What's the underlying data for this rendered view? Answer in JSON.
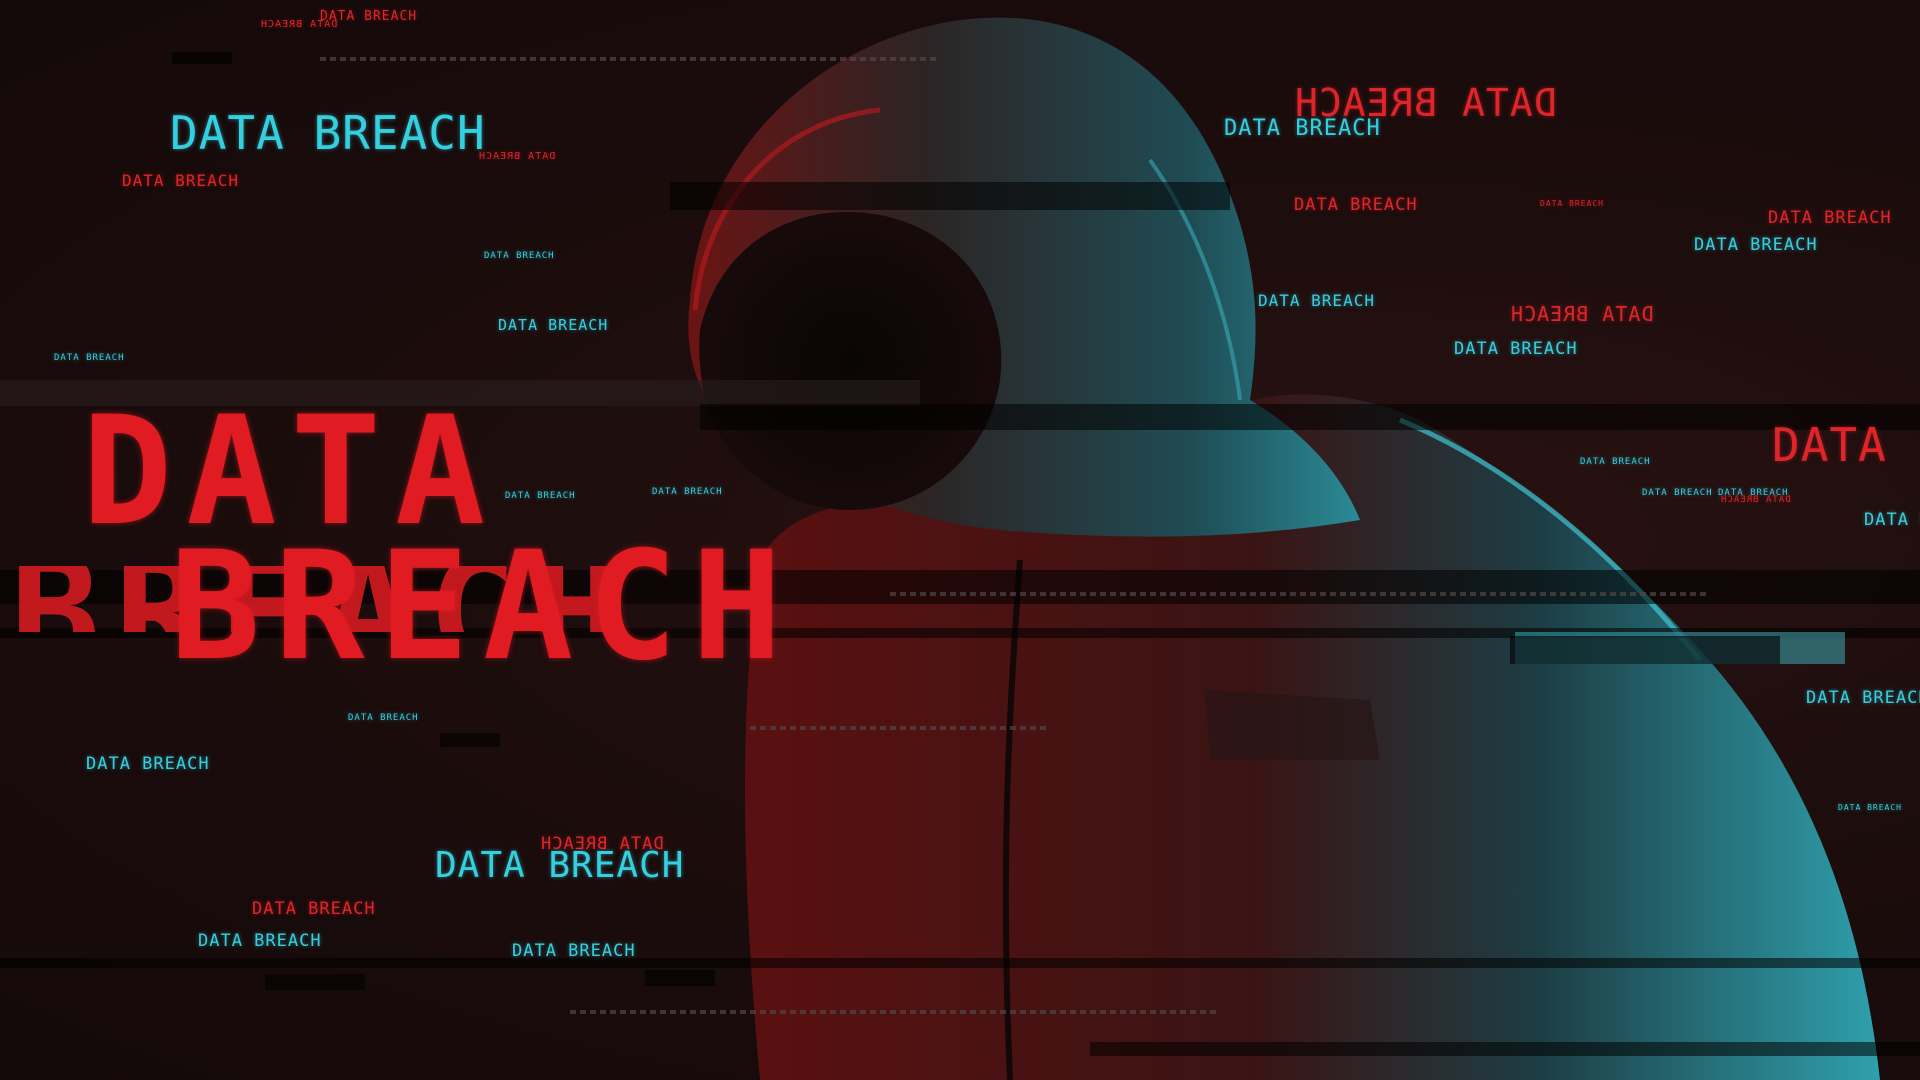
{
  "scene": {
    "subject": "hooded-figure",
    "colors": {
      "background": "#1a0c0c",
      "accent_red": "#e0252a",
      "accent_cyan": "#34d0e0"
    }
  },
  "headline": {
    "line1": "DATA",
    "line2": "BREACH"
  },
  "labels": {
    "l1": "DATA BREACH",
    "l2": "DATA BREACH",
    "l3": "DATA BREACH",
    "l4": "DATA BREACH",
    "l5": "DATA BREACH",
    "l6": "DATA BREACH",
    "l7": "DATA BREACH",
    "l8": "DATA BREACH",
    "l9": "DATA BREACH",
    "l10": "DATA BREACH",
    "l11": "DATA BREACH",
    "l12": "DATA BREACH",
    "l13": "DATA BREACH",
    "l14": "DATA BREACH",
    "l15": "DATA BREACH",
    "l16": "DATA BREACH",
    "l17": "DATA BREACH",
    "l18": "DATA BREACH",
    "l19": "DATA BREACH",
    "l20": "DATA BREACH",
    "l21": "DATA BREACH",
    "l22": "DATA BREACH",
    "l23": "DATA BREACH",
    "l24": "DATA BREACH",
    "l25": "DATA BREACH",
    "l26": "DATA BREACH",
    "l27": "DATA BREACH",
    "l28": "DATA BREACH",
    "l29": "DATA BREACH",
    "l30": "DATA BREACH",
    "l31": "DATA BREACH",
    "l32": "DATA BREACH",
    "l33": "DATA",
    "l34": "DATA E"
  }
}
